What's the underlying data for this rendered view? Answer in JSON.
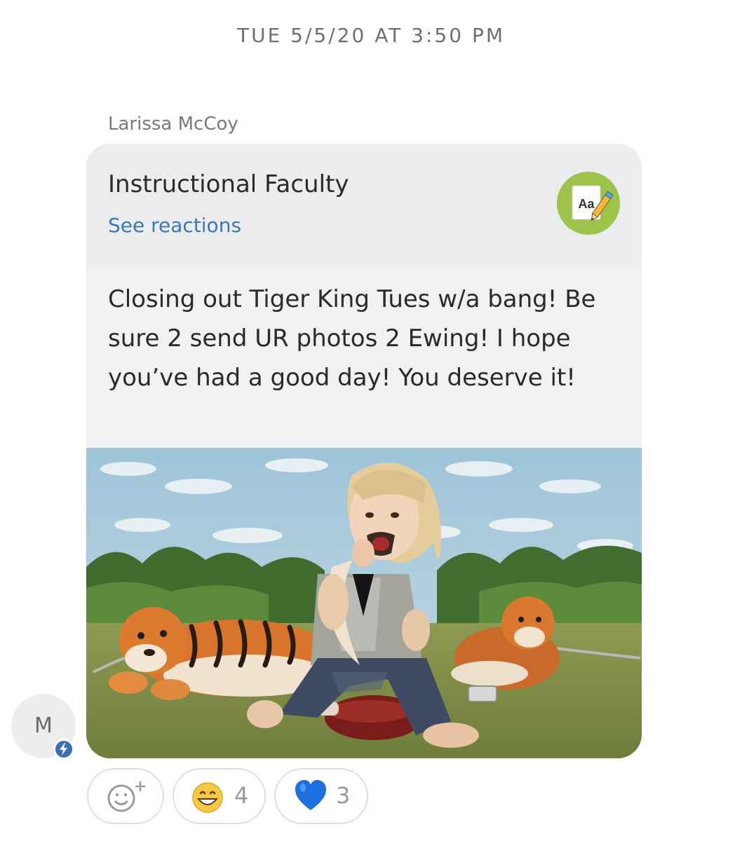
{
  "timestamp": "TUE 5/5/20 AT 3:50 PM",
  "message": {
    "sender": "Larissa McCoy",
    "group_name": "Instructional Faculty",
    "see_reactions": "See reactions",
    "group_avatar_label": "Aa",
    "text": "Closing out Tiger King Tues w/a bang! Be sure 2 send UR photos 2 Ewing! I hope you’ve had a good day! You deserve it!",
    "author_initial": "M"
  },
  "reactions": [
    {
      "icon": "add-reaction-icon",
      "count": ""
    },
    {
      "icon": "grinning-face-icon",
      "count": "4"
    },
    {
      "icon": "blue-heart-icon",
      "count": "3"
    }
  ],
  "colors": {
    "accent_link": "#3a76c2",
    "bubble_bg": "#f0f1f3",
    "group_avatar_bg": "#9dc34a",
    "badge_bg": "#3c6fb6",
    "heart": "#1e6fe0"
  }
}
